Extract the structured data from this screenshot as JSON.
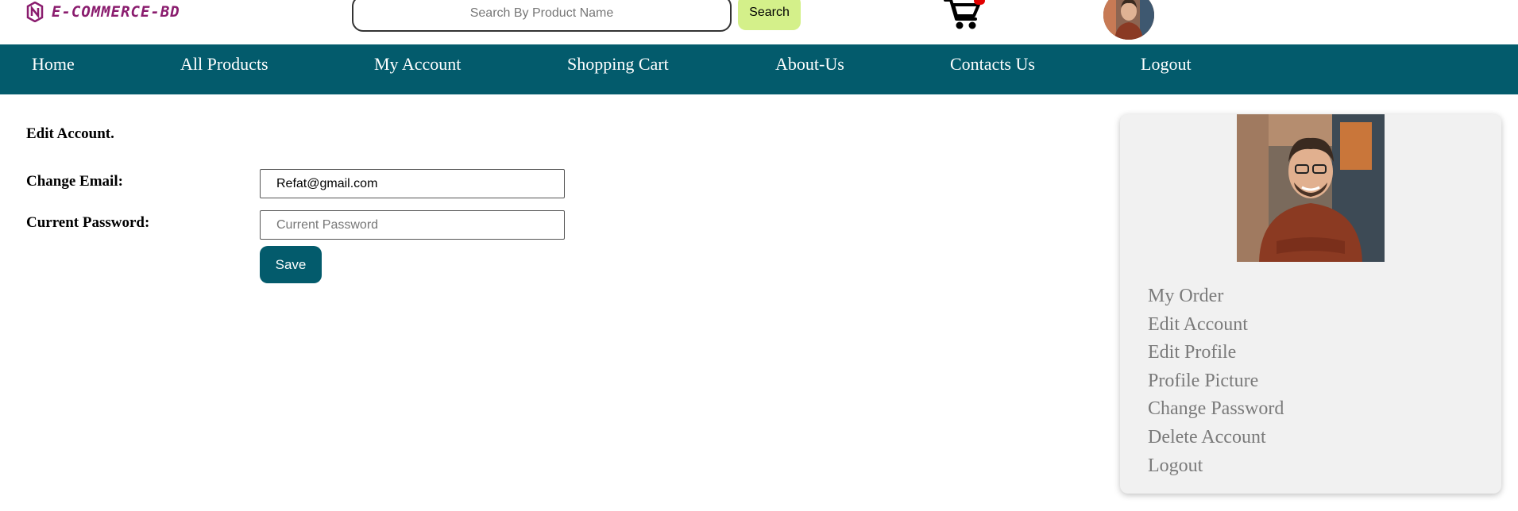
{
  "brand": {
    "name": "E-COMMERCE-BD",
    "color": "#8a1c6e",
    "icon": "brand-logo-icon"
  },
  "search": {
    "placeholder": "Search By Product Name",
    "button_label": "Search"
  },
  "cart": {
    "icon": "shopping-cart-icon"
  },
  "nav": {
    "color": "#035b6c",
    "items": [
      {
        "label": "Home"
      },
      {
        "label": "All Products"
      },
      {
        "label": "My Account"
      },
      {
        "label": "Shopping Cart"
      },
      {
        "label": "About-Us"
      },
      {
        "label": "Contacts Us"
      },
      {
        "label": "Logout"
      }
    ]
  },
  "form": {
    "title": "Edit Account.",
    "email_label": "Change Email:",
    "email_value": "Refat@gmail.com",
    "password_label": "Current Password:",
    "password_placeholder": "Current Password",
    "save_label": "Save"
  },
  "sidebar": {
    "menu": [
      {
        "label": "My Order"
      },
      {
        "label": "Edit Account"
      },
      {
        "label": "Edit Profile"
      },
      {
        "label": "Profile Picture"
      },
      {
        "label": "Change Password"
      },
      {
        "label": "Delete Account"
      },
      {
        "label": "Logout"
      }
    ]
  }
}
